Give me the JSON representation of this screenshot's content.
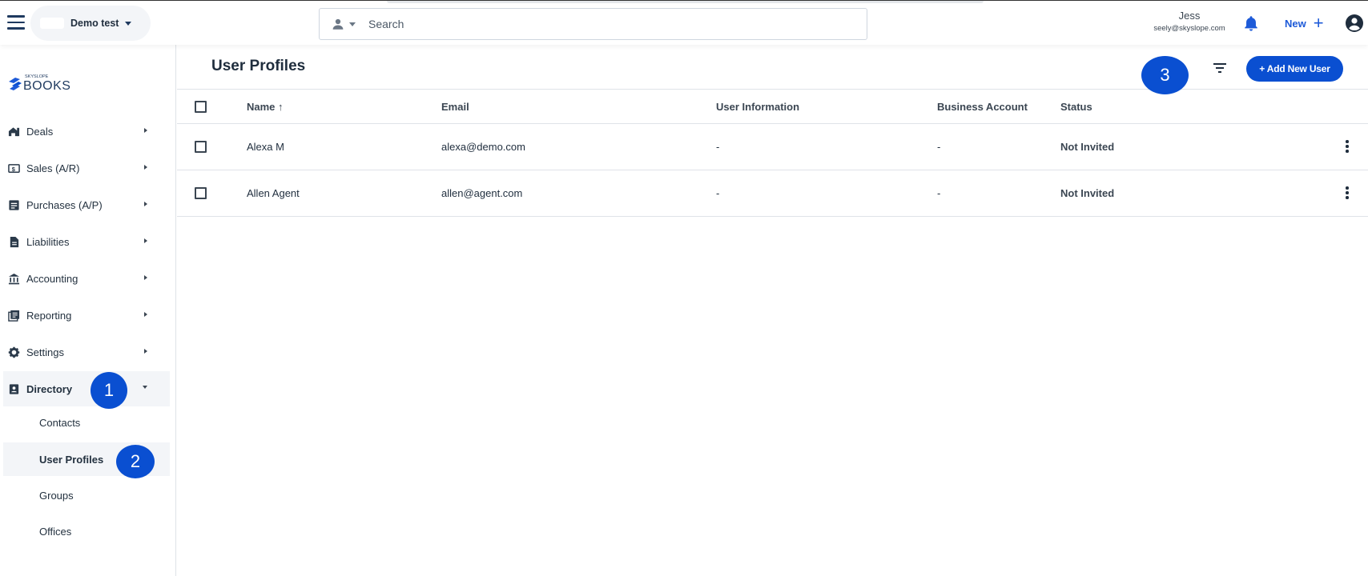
{
  "header": {
    "account_name": "Demo test",
    "search_placeholder": "Search",
    "user_name": "Jess",
    "user_email": "seely@skyslope.com",
    "new_label": "New",
    "new_plus": "+"
  },
  "sidebar": {
    "logo_small": "SKYSLOPE",
    "logo_big": "BOOKS",
    "items": [
      {
        "label": "Deals",
        "icon": "home-icon"
      },
      {
        "label": "Sales (A/R)",
        "icon": "receipt-dollar-icon"
      },
      {
        "label": "Purchases (A/P)",
        "icon": "purchases-icon"
      },
      {
        "label": "Liabilities",
        "icon": "document-icon"
      },
      {
        "label": "Accounting",
        "icon": "bank-icon"
      },
      {
        "label": "Reporting",
        "icon": "report-icon"
      },
      {
        "label": "Settings",
        "icon": "gear-icon"
      },
      {
        "label": "Directory",
        "icon": "contact-card-icon"
      }
    ],
    "directory_subitems": [
      {
        "label": "Contacts"
      },
      {
        "label": "User Profiles"
      },
      {
        "label": "Groups"
      },
      {
        "label": "Offices"
      }
    ]
  },
  "markers": [
    "1",
    "2",
    "3"
  ],
  "main": {
    "title": "User Profiles",
    "add_button": "+ Add New User",
    "columns": [
      "Name ↑",
      "Email",
      "User Information",
      "Business Account",
      "Status"
    ],
    "rows": [
      {
        "name": "Alexa M",
        "email": "alexa@demo.com",
        "user_info": "-",
        "business_account": "-",
        "status": "Not Invited"
      },
      {
        "name": "Allen Agent",
        "email": "allen@agent.com",
        "user_info": "-",
        "business_account": "-",
        "status": "Not Invited"
      }
    ]
  },
  "colors": {
    "accent": "#0a4fd1",
    "link_blue": "#1d5ad8",
    "text_dark": "#1f2d3d"
  }
}
